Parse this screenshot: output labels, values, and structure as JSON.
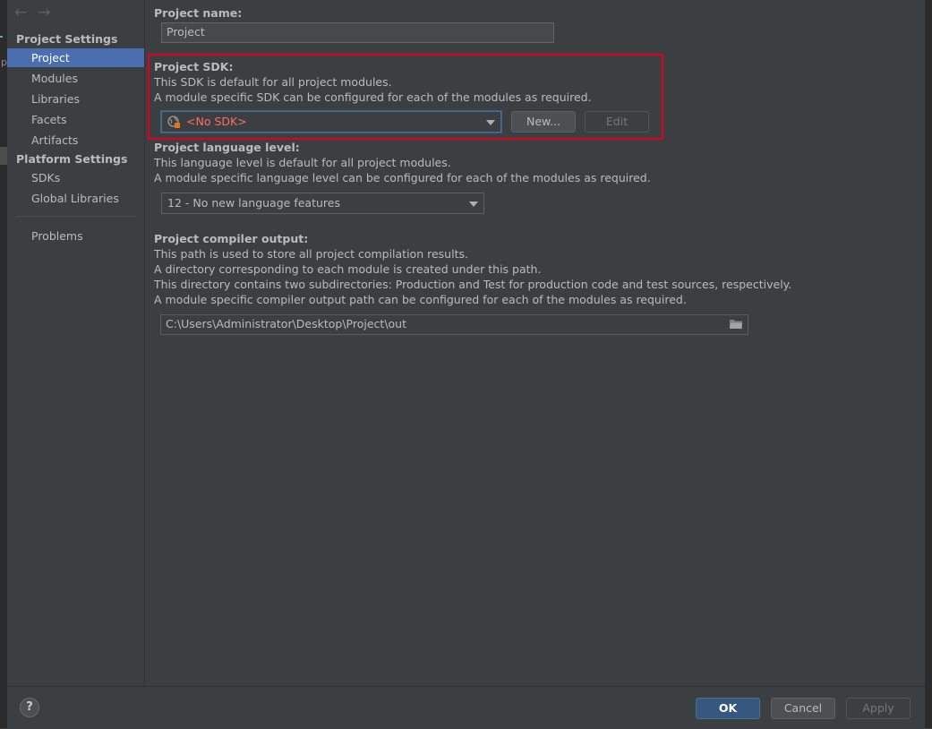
{
  "sidebar": {
    "nav_back": "←",
    "nav_forward": "→",
    "sections": [
      {
        "title": "Project Settings",
        "items": [
          "Project",
          "Modules",
          "Libraries",
          "Facets",
          "Artifacts"
        ]
      },
      {
        "title": "Platform Settings",
        "items": [
          "SDKs",
          "Global Libraries"
        ]
      }
    ],
    "extra_items": [
      "Problems"
    ],
    "selected": "Project",
    "edge_glyph": "p"
  },
  "main": {
    "project_name": {
      "label": "Project name:",
      "value": "Project"
    },
    "project_sdk": {
      "label": "Project SDK:",
      "desc1": "This SDK is default for all project modules.",
      "desc2": "A module specific SDK can be configured for each of the modules as required.",
      "selected": "<No SDK>",
      "new_button": "New...",
      "edit_button": "Edit"
    },
    "language_level": {
      "label": "Project language level:",
      "desc1": "This language level is default for all project modules.",
      "desc2": "A module specific language level can be configured for each of the modules as required.",
      "selected": "12 - No new language features"
    },
    "compiler_output": {
      "label": "Project compiler output:",
      "desc1": "This path is used to store all project compilation results.",
      "desc2": "A directory corresponding to each module is created under this path.",
      "desc3": "This directory contains two subdirectories: Production and Test for production code and test sources, respectively.",
      "desc4": "A module specific compiler output path can be configured for each of the modules as required.",
      "path": "C:\\Users\\Administrator\\Desktop\\Project\\out"
    }
  },
  "footer": {
    "help": "?",
    "ok": "OK",
    "cancel": "Cancel",
    "apply": "Apply"
  },
  "colors": {
    "highlight_box": "#e0001b",
    "selection": "#4b6eaf",
    "error_text": "#ff6b68"
  }
}
